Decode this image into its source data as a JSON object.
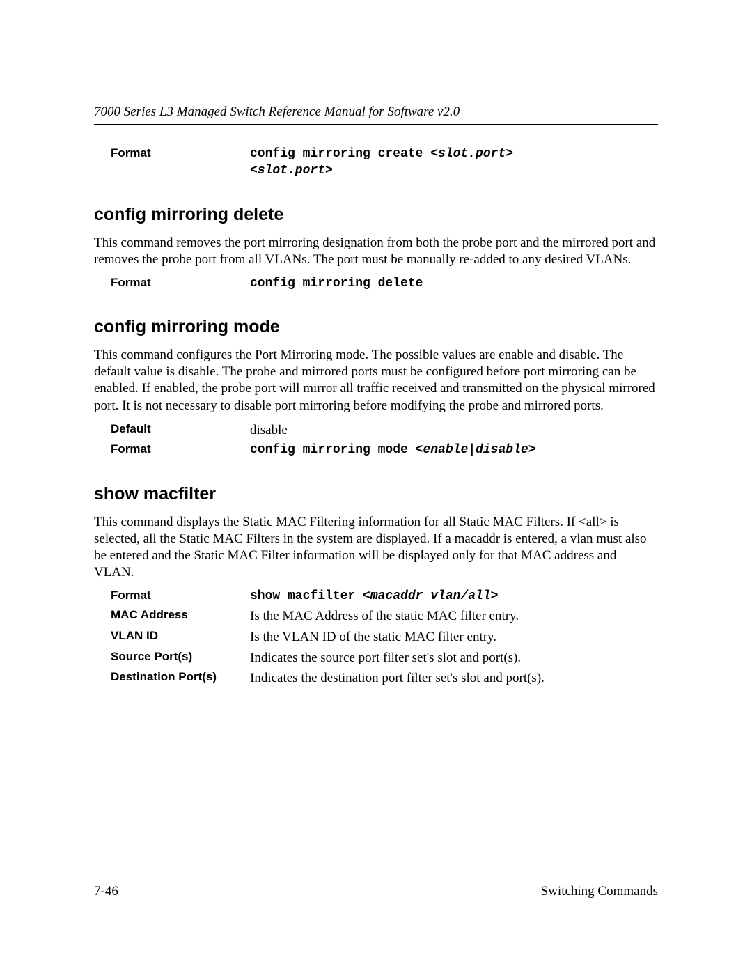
{
  "header": {
    "running_title": "7000 Series L3 Managed Switch Reference Manual for Software v2.0"
  },
  "sec0": {
    "fmt_label": "Format",
    "fmt_cmd": "config mirroring create ",
    "fmt_arg1": "<slot.port>",
    "fmt_arg2": "<slot.port>"
  },
  "sec1": {
    "title": "config mirroring delete",
    "body": "This command removes the port mirroring designation from both the probe port and the mirrored port and removes the probe port from all VLANs. The port must be manually re-added to any desired VLANs.",
    "fmt_label": "Format",
    "fmt_cmd": "config mirroring delete"
  },
  "sec2": {
    "title": "config mirroring mode",
    "body": "This command configures the Port Mirroring mode. The possible values are enable and disable. The default value is disable. The probe and mirrored ports must be configured before port mirroring can be enabled. If enabled, the probe port will mirror all traffic received and transmitted on the physical mirrored port. It is not necessary to disable port mirroring before modifying the probe and mirrored ports.",
    "def_label": "Default",
    "def_val": "disable",
    "fmt_label": "Format",
    "fmt_cmd": "config mirroring mode ",
    "fmt_arg": "<enable|disable>"
  },
  "sec3": {
    "title": "show macfilter",
    "body": "This command displays the Static MAC Filtering information for all Static MAC Filters. If <all> is selected, all the Static MAC Filters in the system are displayed. If a macaddr is entered, a vlan must also be entered and the Static MAC Filter information will be displayed only for that MAC address and VLAN.",
    "rows": {
      "r0": {
        "label": "Format",
        "cmd": "show macfilter ",
        "arg": "<macaddr vlan/all>"
      },
      "r1": {
        "label": "MAC Address",
        "val": "Is the MAC Address of the static MAC filter entry."
      },
      "r2": {
        "label": "VLAN ID",
        "val": "Is the VLAN ID of the static MAC filter entry."
      },
      "r3": {
        "label": "Source Port(s)",
        "val": "Indicates the source port filter set's slot and port(s)."
      },
      "r4": {
        "label": "Destination Port(s)",
        "val": "Indicates the destination port filter set's slot and port(s)."
      }
    }
  },
  "footer": {
    "page": "7-46",
    "chapter": "Switching Commands"
  }
}
